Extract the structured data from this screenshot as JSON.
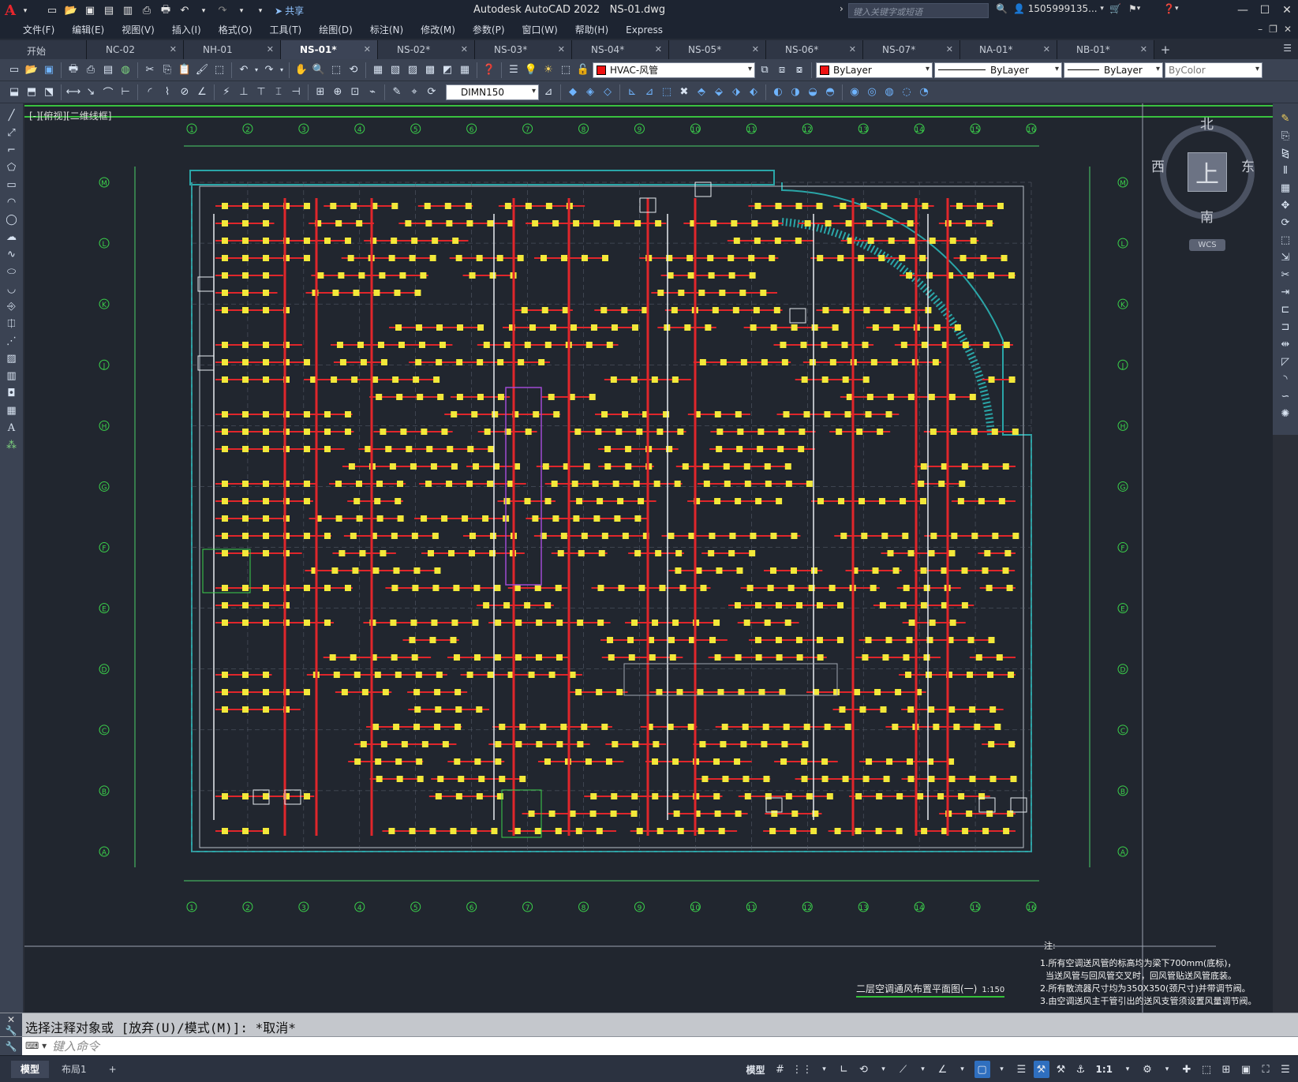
{
  "titlebar": {
    "app_title": "Autodesk AutoCAD 2022",
    "file_name": "NS-01.dwg",
    "share_label": "共享",
    "search_placeholder": "键入关键字或短语",
    "user_name": "1505999135...",
    "help_icon": "help-icon"
  },
  "menu": [
    "文件(F)",
    "编辑(E)",
    "视图(V)",
    "插入(I)",
    "格式(O)",
    "工具(T)",
    "绘图(D)",
    "标注(N)",
    "修改(M)",
    "参数(P)",
    "窗口(W)",
    "帮助(H)",
    "Express"
  ],
  "tabs": [
    {
      "label": "开始",
      "active": false,
      "closable": false
    },
    {
      "label": "NC-02",
      "active": false,
      "closable": true
    },
    {
      "label": "NH-01",
      "active": false,
      "closable": true
    },
    {
      "label": "NS-01*",
      "active": true,
      "closable": true
    },
    {
      "label": "NS-02*",
      "active": false,
      "closable": true
    },
    {
      "label": "NS-03*",
      "active": false,
      "closable": true
    },
    {
      "label": "NS-04*",
      "active": false,
      "closable": true
    },
    {
      "label": "NS-05*",
      "active": false,
      "closable": true
    },
    {
      "label": "NS-06*",
      "active": false,
      "closable": true
    },
    {
      "label": "NS-07*",
      "active": false,
      "closable": true
    },
    {
      "label": "NA-01*",
      "active": false,
      "closable": true
    },
    {
      "label": "NB-01*",
      "active": false,
      "closable": true
    }
  ],
  "toolbar": {
    "layer_name": "HVAC-风管",
    "color_value": "ByLayer",
    "linetype_value": "ByLayer",
    "lineweight_value": "ByLayer",
    "plotstyle_value": "ByColor",
    "dimstyle_value": "DIMN150",
    "layer_color": "#ee1111"
  },
  "viewport": {
    "label": "[-][俯视][二维线框]"
  },
  "viewcube": {
    "north": "北",
    "south": "南",
    "east": "东",
    "west": "西",
    "face": "上",
    "wcs": "WCS"
  },
  "drawing": {
    "grid_columns": [
      "1",
      "2",
      "3",
      "4",
      "5",
      "6",
      "7",
      "8",
      "9",
      "10",
      "11",
      "12",
      "13",
      "14",
      "15",
      "16"
    ],
    "grid_rows": [
      "M",
      "L",
      "K",
      "J",
      "H",
      "G",
      "F",
      "E",
      "D",
      "C",
      "B",
      "A"
    ],
    "plan_title": "二层空调通风布置平面图(一)",
    "plan_scale": "1:150",
    "notes_header": "注:",
    "notes": [
      "1.所有空调送风管的标高均为梁下700mm(底标)，",
      "  当送风管与回风管交叉时，回风管贴送风管底装。",
      "2.所有散流器尺寸均为350X350(颈尺寸)并带调节阀。",
      "3.由空调送风主干管引出的送风支管须设置风量调节阀。"
    ]
  },
  "command": {
    "history": "选择注释对象或 [放弃(U)/模式(M)]: *取消*",
    "placeholder": "键入命令"
  },
  "status": {
    "layouts": [
      "模型",
      "布局1"
    ],
    "model_label": "模型",
    "scale": "1:1"
  }
}
